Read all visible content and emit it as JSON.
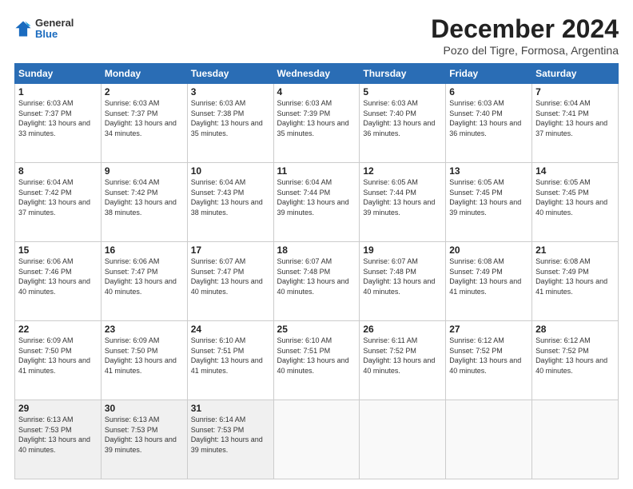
{
  "header": {
    "logo_general": "General",
    "logo_blue": "Blue",
    "month_title": "December 2024",
    "location": "Pozo del Tigre, Formosa, Argentina"
  },
  "weekdays": [
    "Sunday",
    "Monday",
    "Tuesday",
    "Wednesday",
    "Thursday",
    "Friday",
    "Saturday"
  ],
  "weeks": [
    [
      {
        "day": "1",
        "sunrise": "6:03 AM",
        "sunset": "7:37 PM",
        "daylight": "13 hours and 33 minutes."
      },
      {
        "day": "2",
        "sunrise": "6:03 AM",
        "sunset": "7:37 PM",
        "daylight": "13 hours and 34 minutes."
      },
      {
        "day": "3",
        "sunrise": "6:03 AM",
        "sunset": "7:38 PM",
        "daylight": "13 hours and 35 minutes."
      },
      {
        "day": "4",
        "sunrise": "6:03 AM",
        "sunset": "7:39 PM",
        "daylight": "13 hours and 35 minutes."
      },
      {
        "day": "5",
        "sunrise": "6:03 AM",
        "sunset": "7:40 PM",
        "daylight": "13 hours and 36 minutes."
      },
      {
        "day": "6",
        "sunrise": "6:03 AM",
        "sunset": "7:40 PM",
        "daylight": "13 hours and 36 minutes."
      },
      {
        "day": "7",
        "sunrise": "6:04 AM",
        "sunset": "7:41 PM",
        "daylight": "13 hours and 37 minutes."
      }
    ],
    [
      {
        "day": "8",
        "sunrise": "6:04 AM",
        "sunset": "7:42 PM",
        "daylight": "13 hours and 37 minutes."
      },
      {
        "day": "9",
        "sunrise": "6:04 AM",
        "sunset": "7:42 PM",
        "daylight": "13 hours and 38 minutes."
      },
      {
        "day": "10",
        "sunrise": "6:04 AM",
        "sunset": "7:43 PM",
        "daylight": "13 hours and 38 minutes."
      },
      {
        "day": "11",
        "sunrise": "6:04 AM",
        "sunset": "7:44 PM",
        "daylight": "13 hours and 39 minutes."
      },
      {
        "day": "12",
        "sunrise": "6:05 AM",
        "sunset": "7:44 PM",
        "daylight": "13 hours and 39 minutes."
      },
      {
        "day": "13",
        "sunrise": "6:05 AM",
        "sunset": "7:45 PM",
        "daylight": "13 hours and 39 minutes."
      },
      {
        "day": "14",
        "sunrise": "6:05 AM",
        "sunset": "7:45 PM",
        "daylight": "13 hours and 40 minutes."
      }
    ],
    [
      {
        "day": "15",
        "sunrise": "6:06 AM",
        "sunset": "7:46 PM",
        "daylight": "13 hours and 40 minutes."
      },
      {
        "day": "16",
        "sunrise": "6:06 AM",
        "sunset": "7:47 PM",
        "daylight": "13 hours and 40 minutes."
      },
      {
        "day": "17",
        "sunrise": "6:07 AM",
        "sunset": "7:47 PM",
        "daylight": "13 hours and 40 minutes."
      },
      {
        "day": "18",
        "sunrise": "6:07 AM",
        "sunset": "7:48 PM",
        "daylight": "13 hours and 40 minutes."
      },
      {
        "day": "19",
        "sunrise": "6:07 AM",
        "sunset": "7:48 PM",
        "daylight": "13 hours and 40 minutes."
      },
      {
        "day": "20",
        "sunrise": "6:08 AM",
        "sunset": "7:49 PM",
        "daylight": "13 hours and 41 minutes."
      },
      {
        "day": "21",
        "sunrise": "6:08 AM",
        "sunset": "7:49 PM",
        "daylight": "13 hours and 41 minutes."
      }
    ],
    [
      {
        "day": "22",
        "sunrise": "6:09 AM",
        "sunset": "7:50 PM",
        "daylight": "13 hours and 41 minutes."
      },
      {
        "day": "23",
        "sunrise": "6:09 AM",
        "sunset": "7:50 PM",
        "daylight": "13 hours and 41 minutes."
      },
      {
        "day": "24",
        "sunrise": "6:10 AM",
        "sunset": "7:51 PM",
        "daylight": "13 hours and 41 minutes."
      },
      {
        "day": "25",
        "sunrise": "6:10 AM",
        "sunset": "7:51 PM",
        "daylight": "13 hours and 40 minutes."
      },
      {
        "day": "26",
        "sunrise": "6:11 AM",
        "sunset": "7:52 PM",
        "daylight": "13 hours and 40 minutes."
      },
      {
        "day": "27",
        "sunrise": "6:12 AM",
        "sunset": "7:52 PM",
        "daylight": "13 hours and 40 minutes."
      },
      {
        "day": "28",
        "sunrise": "6:12 AM",
        "sunset": "7:52 PM",
        "daylight": "13 hours and 40 minutes."
      }
    ],
    [
      {
        "day": "29",
        "sunrise": "6:13 AM",
        "sunset": "7:53 PM",
        "daylight": "13 hours and 40 minutes."
      },
      {
        "day": "30",
        "sunrise": "6:13 AM",
        "sunset": "7:53 PM",
        "daylight": "13 hours and 39 minutes."
      },
      {
        "day": "31",
        "sunrise": "6:14 AM",
        "sunset": "7:53 PM",
        "daylight": "13 hours and 39 minutes."
      },
      null,
      null,
      null,
      null
    ]
  ]
}
